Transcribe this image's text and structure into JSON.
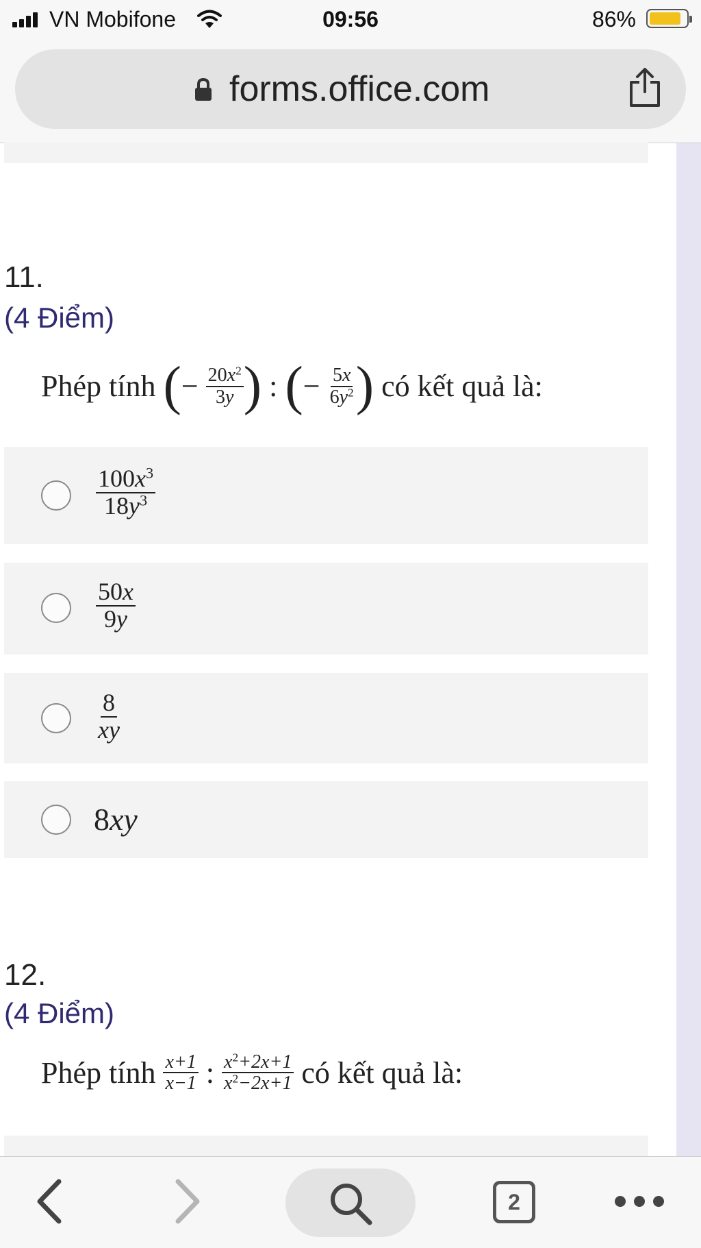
{
  "status_bar": {
    "carrier": "VN Mobifone",
    "time": "09:56",
    "battery_percent": "86%",
    "battery_level": 0.86,
    "battery_color": "#f3c11b"
  },
  "address_bar": {
    "url": "forms.office.com",
    "icons": [
      "lock-icon",
      "share-icon"
    ]
  },
  "questions": [
    {
      "number": "11.",
      "points": "(4 Điểm)",
      "prompt": {
        "prefix": "Phép tính",
        "operand1": {
          "sign": "−",
          "num_coef": "20",
          "num_var": "x",
          "num_exp": "2",
          "den_coef": "3",
          "den_var": "y"
        },
        "operator": ":",
        "operand2": {
          "sign": "−",
          "num_coef": "5",
          "num_var": "x",
          "den_coef": "6",
          "den_var": "y",
          "den_exp": "2"
        },
        "suffix": "có kết quả là:"
      },
      "options": [
        {
          "num_coef": "100",
          "num_var": "x",
          "num_exp": "3",
          "den_coef": "18",
          "den_var": "y",
          "den_exp": "3"
        },
        {
          "num_coef": "50",
          "num_var": "x",
          "den_coef": "9",
          "den_var": "y"
        },
        {
          "num_coef": "8",
          "den_var": "xy"
        },
        {
          "coef": "8",
          "var": "xy"
        }
      ]
    },
    {
      "number": "12.",
      "points": "(4 Điểm)",
      "prompt": {
        "prefix": "Phép tính",
        "frac1": {
          "num": "x+1",
          "den": "x−1"
        },
        "operator": ":",
        "frac2": {
          "num_a": "x",
          "num_exp": "2",
          "num_b": "+2x+1",
          "den_a": "x",
          "den_exp": "2",
          "den_b": "−2x+1"
        },
        "suffix": "có kết quả là:"
      }
    }
  ],
  "bottom_bar": {
    "tab_count": "2",
    "icons": [
      "back-icon",
      "forward-icon",
      "search-icon",
      "tabs-icon",
      "more-icon"
    ]
  },
  "colors": {
    "points_text": "#2f2a72",
    "option_background": "#f3f3f3",
    "side_strip": "#e6e4f2"
  }
}
